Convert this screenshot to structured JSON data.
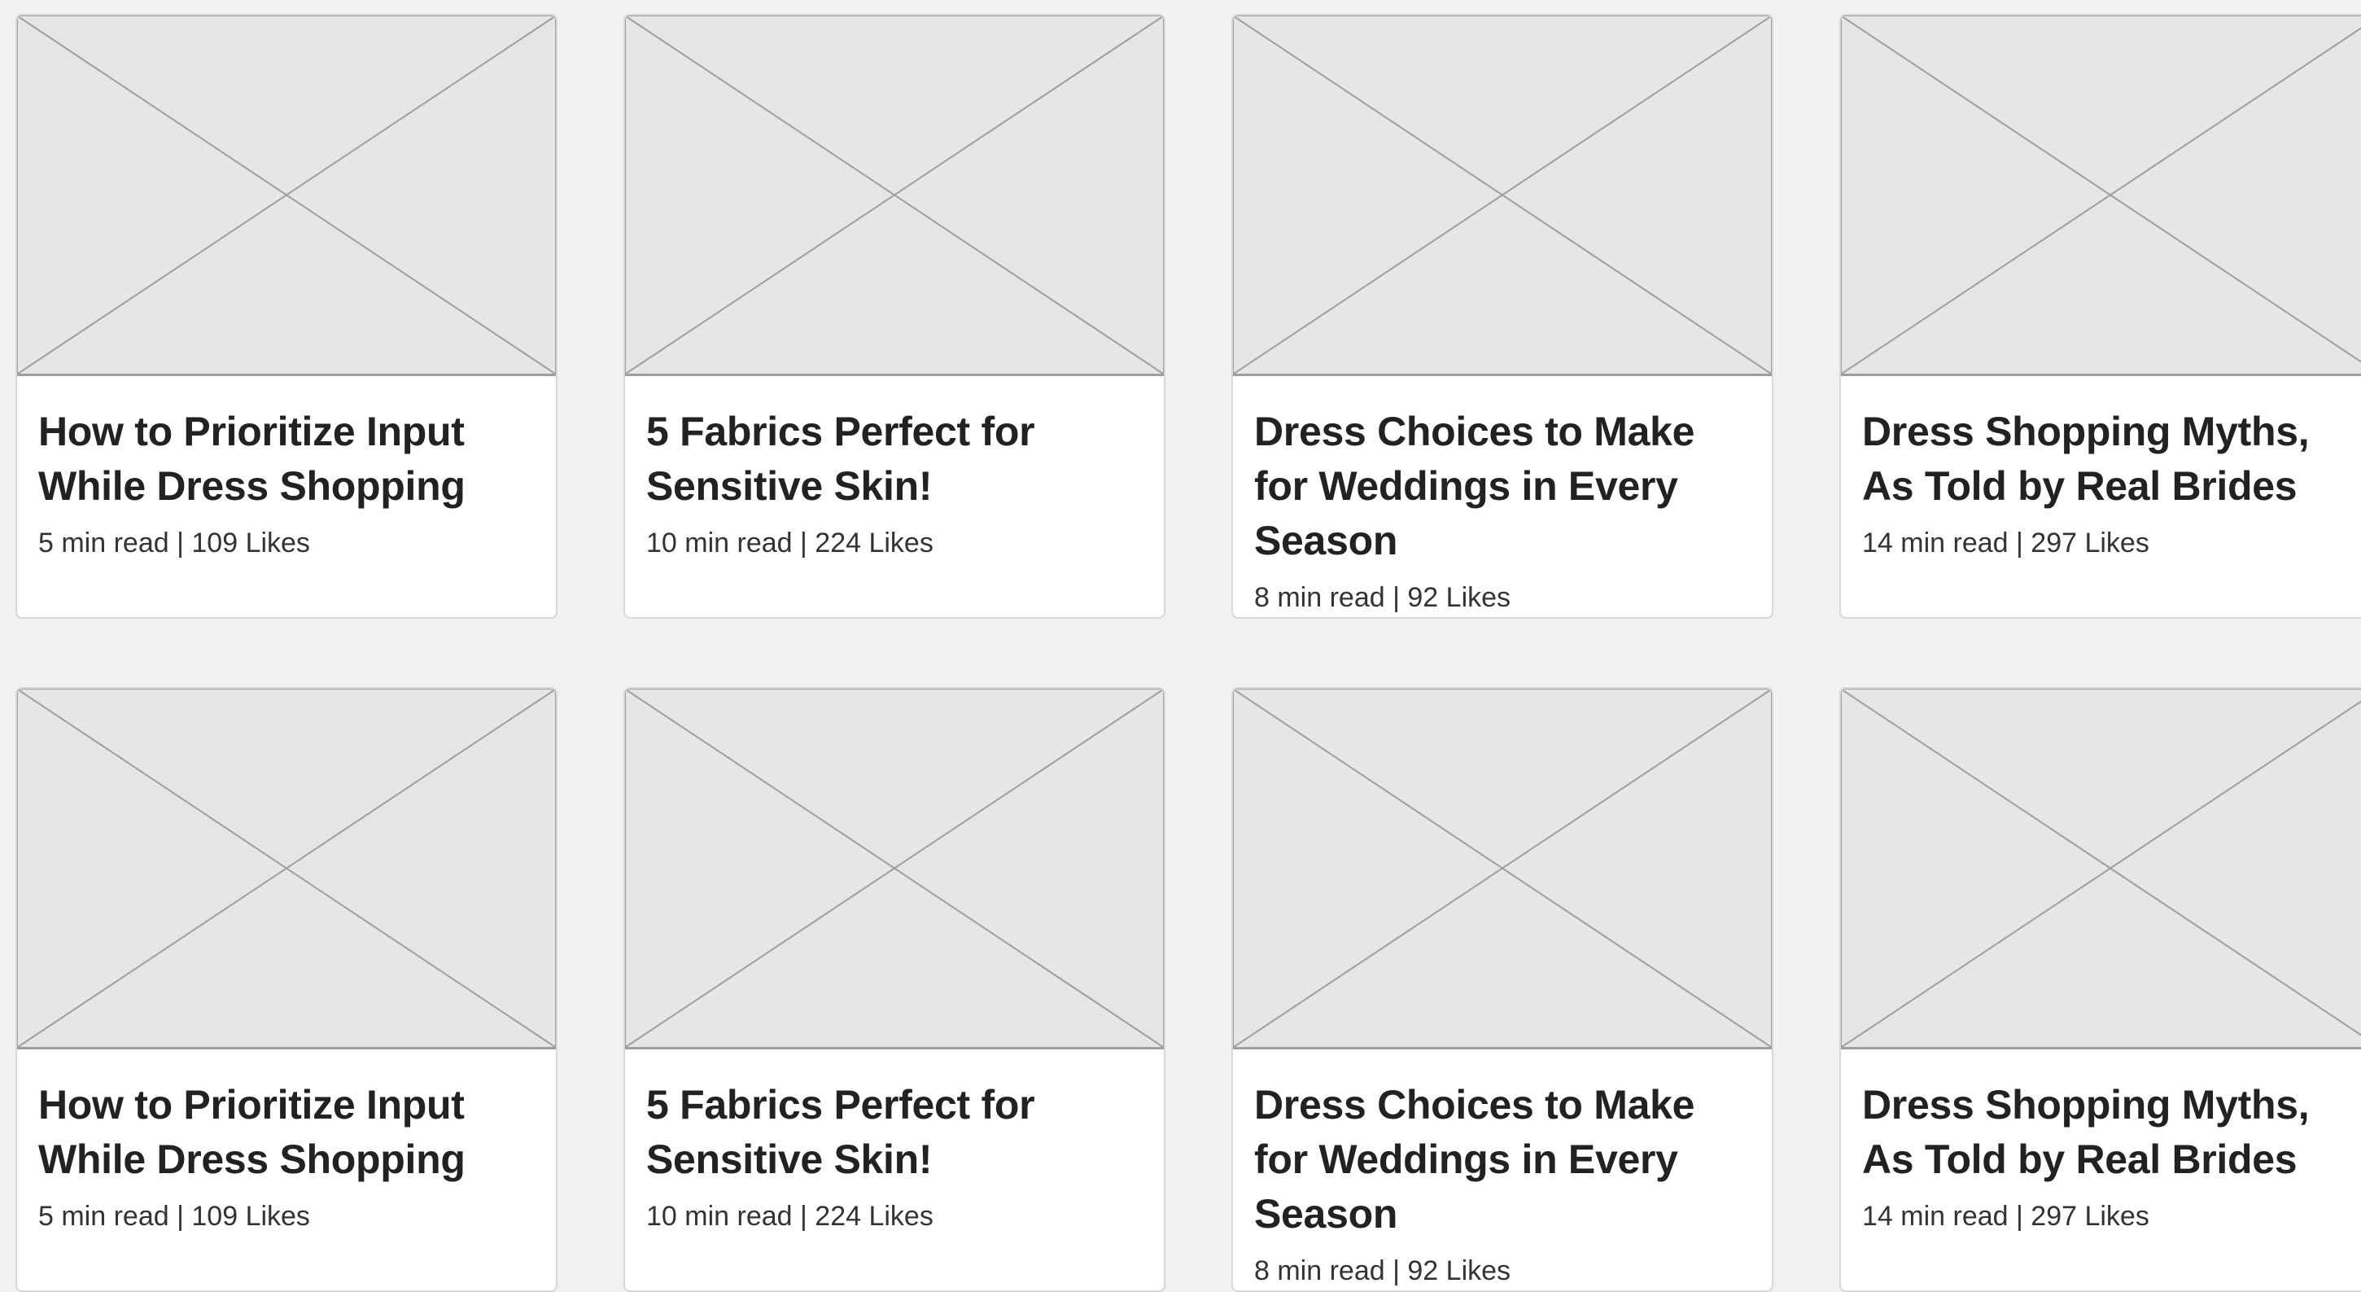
{
  "cards": [
    {
      "title": "How to Prioritize Input While Dress Shopping",
      "read_time": "5 min read",
      "separator": "|",
      "likes": "109 Likes"
    },
    {
      "title": "5 Fabrics Perfect for Sensitive Skin!",
      "read_time": "10 min read",
      "separator": "|",
      "likes": "224 Likes"
    },
    {
      "title": "Dress Choices to Make for Weddings in Every Season",
      "read_time": "8 min read",
      "separator": "|",
      "likes": "92 Likes"
    },
    {
      "title": "Dress Shopping Myths, As Told by Real Brides",
      "read_time": "14 min read",
      "separator": "|",
      "likes": "297 Likes"
    },
    {
      "title": "How to Prioritize Input While Dress Shopping",
      "read_time": "5 min read",
      "separator": "|",
      "likes": "109 Likes"
    },
    {
      "title": "5 Fabrics Perfect for Sensitive Skin!",
      "read_time": "10 min read",
      "separator": "|",
      "likes": "224 Likes"
    },
    {
      "title": "Dress Choices to Make for Weddings in Every Season",
      "read_time": "8 min read",
      "separator": "|",
      "likes": "92 Likes"
    },
    {
      "title": "Dress Shopping Myths, As Told by Real Brides",
      "read_time": "14 min read",
      "separator": "|",
      "likes": "297 Likes"
    }
  ],
  "colors": {
    "background": "#f1f1f1",
    "card": "#ffffff",
    "placeholder_fill": "#e6e6e6",
    "placeholder_stroke": "#9e9e9e",
    "title_text": "#222222",
    "meta_text": "#333333"
  },
  "icons": {
    "thumbnail": "image-placeholder-icon"
  }
}
